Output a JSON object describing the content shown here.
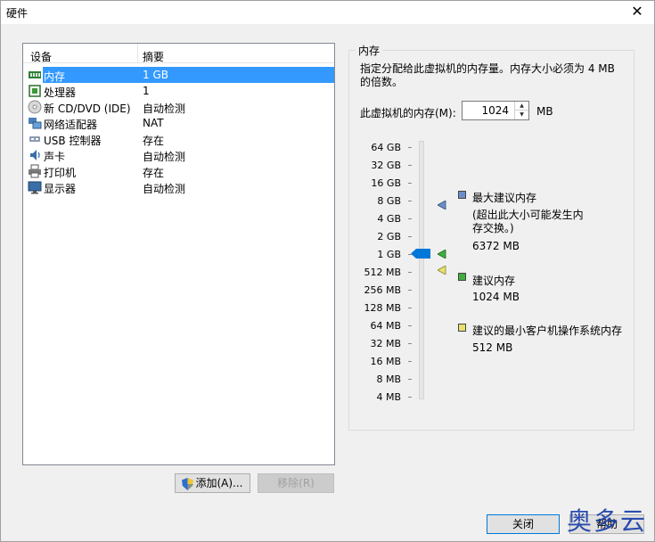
{
  "window": {
    "title": "硬件"
  },
  "device_list": {
    "columns": [
      "设备",
      "摘要"
    ],
    "rows": [
      {
        "name": "内存",
        "summary": "1 GB",
        "icon": "memory-icon",
        "selected": true
      },
      {
        "name": "处理器",
        "summary": "1",
        "icon": "cpu-icon"
      },
      {
        "name": "新 CD/DVD (IDE)",
        "summary": "自动检测",
        "icon": "cd-icon"
      },
      {
        "name": "网络适配器",
        "summary": "NAT",
        "icon": "network-icon"
      },
      {
        "name": "USB 控制器",
        "summary": "存在",
        "icon": "usb-icon"
      },
      {
        "name": "声卡",
        "summary": "自动检测",
        "icon": "sound-icon"
      },
      {
        "name": "打印机",
        "summary": "存在",
        "icon": "printer-icon"
      },
      {
        "name": "显示器",
        "summary": "自动检测",
        "icon": "display-icon"
      }
    ]
  },
  "buttons": {
    "add": "添加(A)...",
    "remove": "移除(R)",
    "close": "关闭",
    "help": "帮助"
  },
  "memory": {
    "group_title": "内存",
    "description": "指定分配给此虚拟机的内存量。内存大小必须为 4 MB 的倍数。",
    "field_label": "此虚拟机的内存(M):",
    "value": "1024",
    "unit": "MB",
    "scale": [
      "64 GB",
      "32 GB",
      "16 GB",
      "8 GB",
      "4 GB",
      "2 GB",
      "1 GB",
      "512 MB",
      "256 MB",
      "128 MB",
      "64 MB",
      "32 MB",
      "16 MB",
      "8 MB",
      "4 MB"
    ],
    "legend": {
      "max_label": "最大建议内存",
      "max_note": "(超出此大小可能发生内存交换。)",
      "max_value": "6372 MB",
      "rec_label": "建议内存",
      "rec_value": "1024 MB",
      "min_label": "建议的最小客户机操作系统内存",
      "min_value": "512 MB"
    },
    "colors": {
      "max": "#6a8fc8",
      "rec": "#3fae3f",
      "min": "#e8e070",
      "thumb": "#0078d7"
    }
  },
  "watermark": "奥多云"
}
